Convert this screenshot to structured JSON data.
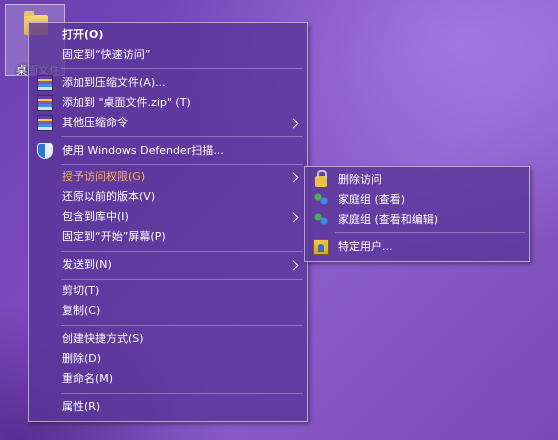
{
  "desktop_icon": {
    "label": "桌面文件"
  },
  "main_menu": {
    "items": [
      {
        "label": "打开(O)"
      },
      {
        "label": "固定到“快速访问”"
      },
      {
        "label": "添加到压缩文件(A)...",
        "icon": "winrar-icon"
      },
      {
        "label": "添加到 \"桌面文件.zip\" (T)",
        "icon": "winrar-icon"
      },
      {
        "label": "其他压缩命令",
        "icon": "winrar-icon",
        "submenu": true
      },
      {
        "label": "使用 Windows Defender扫描...",
        "icon": "defender-shield-icon"
      },
      {
        "label": "授予访问权限(G)",
        "submenu": true,
        "highlight_color": "#ffb347"
      },
      {
        "label": "还原以前的版本(V)"
      },
      {
        "label": "包含到库中(I)",
        "submenu": true
      },
      {
        "label": "固定到“开始”屏幕(P)"
      },
      {
        "label": "发送到(N)",
        "submenu": true
      },
      {
        "label": "剪切(T)"
      },
      {
        "label": "复制(C)"
      },
      {
        "label": "创建快捷方式(S)"
      },
      {
        "label": "删除(D)"
      },
      {
        "label": "重命名(M)"
      },
      {
        "label": "属性(R)"
      }
    ]
  },
  "sub_menu": {
    "items": [
      {
        "label": "删除访问",
        "icon": "lock-icon"
      },
      {
        "label": "家庭组 (查看)",
        "icon": "homegroup-icon"
      },
      {
        "label": "家庭组 (查看和编辑)",
        "icon": "homegroup-icon"
      },
      {
        "label": "特定用户...",
        "icon": "user-icon"
      }
    ]
  }
}
